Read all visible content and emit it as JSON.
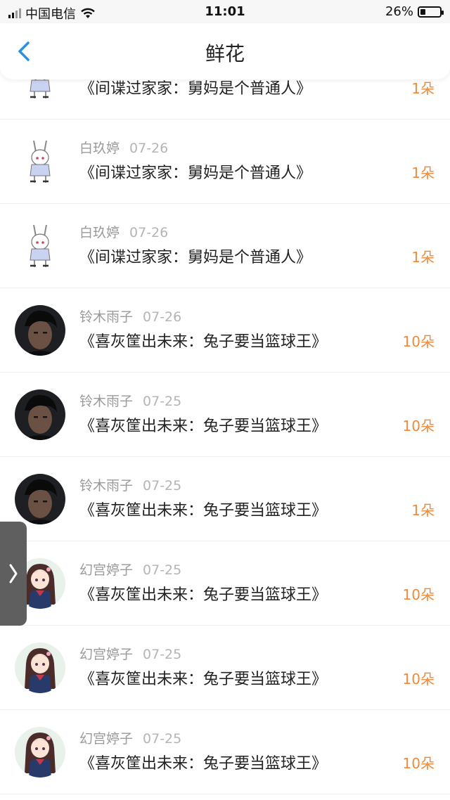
{
  "status": {
    "carrier": "中国电信",
    "time": "11:01",
    "battery": "26%",
    "battery_level": 0.26
  },
  "nav": {
    "title": "鲜花"
  },
  "rows": [
    {
      "user": "",
      "date": "",
      "book": "《间谍过家家：舅妈是个普通人》",
      "count": "1朵",
      "avatar": "bunny-girl-avatar"
    },
    {
      "user": "白玖婷",
      "date": "07-26",
      "book": "《间谍过家家：舅妈是个普通人》",
      "count": "1朵",
      "avatar": "bunny-girl-avatar"
    },
    {
      "user": "白玖婷",
      "date": "07-26",
      "book": "《间谍过家家：舅妈是个普通人》",
      "count": "1朵",
      "avatar": "bunny-girl-avatar"
    },
    {
      "user": "铃木雨子",
      "date": "07-26",
      "book": "《喜灰筐出未来：兔子要当篮球王》",
      "count": "10朵",
      "avatar": "dark-photo-avatar"
    },
    {
      "user": "铃木雨子",
      "date": "07-25",
      "book": "《喜灰筐出未来：兔子要当篮球王》",
      "count": "10朵",
      "avatar": "dark-photo-avatar"
    },
    {
      "user": "铃木雨子",
      "date": "07-25",
      "book": "《喜灰筐出未来：兔子要当篮球王》",
      "count": "1朵",
      "avatar": "dark-photo-avatar"
    },
    {
      "user": "幻宫婷子",
      "date": "07-25",
      "book": "《喜灰筐出未来：兔子要当篮球王》",
      "count": "10朵",
      "avatar": "anime-girl-avatar"
    },
    {
      "user": "幻宫婷子",
      "date": "07-25",
      "book": "《喜灰筐出未来：兔子要当篮球王》",
      "count": "10朵",
      "avatar": "anime-girl-avatar"
    },
    {
      "user": "幻宫婷子",
      "date": "07-25",
      "book": "《喜灰筐出未来：兔子要当篮球王》",
      "count": "10朵",
      "avatar": "anime-girl-avatar"
    }
  ],
  "colors": {
    "accent": "#2a8fe6",
    "count": "#f08a3a",
    "handle": "#5f5f5f"
  }
}
